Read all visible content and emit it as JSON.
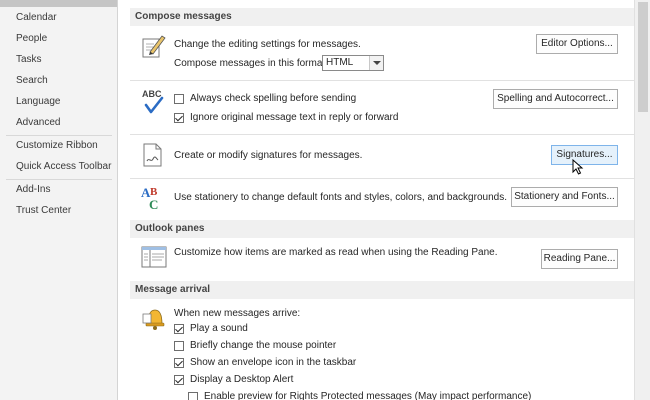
{
  "sidebar": {
    "items": [
      {
        "label": "Calendar"
      },
      {
        "label": "People"
      },
      {
        "label": "Tasks"
      },
      {
        "label": "Search"
      },
      {
        "label": "Language"
      },
      {
        "label": "Advanced"
      },
      {
        "label": "Customize Ribbon"
      },
      {
        "label": "Quick Access Toolbar"
      },
      {
        "label": "Add-Ins"
      },
      {
        "label": "Trust Center"
      }
    ]
  },
  "compose": {
    "heading": "Compose messages",
    "editing_text": "Change the editing settings for messages.",
    "editor_options_button": "Editor Options...",
    "format_label": "Compose messages in this format:",
    "format_value": "HTML",
    "always_check_spelling": "Always check spelling before sending",
    "ignore_original": "Ignore original message text in reply or forward",
    "spelling_button": "Spelling and Autocorrect...",
    "signatures_text": "Create or modify signatures for messages.",
    "signatures_button": "Signatures...",
    "stationery_text": "Use stationery to change default fonts and styles, colors, and backgrounds.",
    "stationery_button": "Stationery and Fonts...",
    "spelling_icon_text": "ABC",
    "stationery_icon_a": "A",
    "stationery_icon_b": "B",
    "stationery_icon_c": "C"
  },
  "outlook_panes": {
    "heading": "Outlook panes",
    "text": "Customize how items are marked as read when using the Reading Pane.",
    "reading_pane_button": "Reading Pane..."
  },
  "message_arrival": {
    "heading": "Message arrival",
    "intro": "When new messages arrive:",
    "options": [
      {
        "label": "Play a sound",
        "checked": true
      },
      {
        "label": "Briefly change the mouse pointer",
        "checked": false
      },
      {
        "label": "Show an envelope icon in the taskbar",
        "checked": true
      },
      {
        "label": "Display a Desktop Alert",
        "checked": true
      },
      {
        "label": "Enable preview for Rights Protected messages (May impact performance)",
        "checked": false
      }
    ]
  },
  "colors": {
    "sidebar_bg": "#f3f3f3",
    "section_bg": "#f0f0f0",
    "button_hover": "#e5f1fb",
    "accent_blue": "#2b6cc4"
  }
}
